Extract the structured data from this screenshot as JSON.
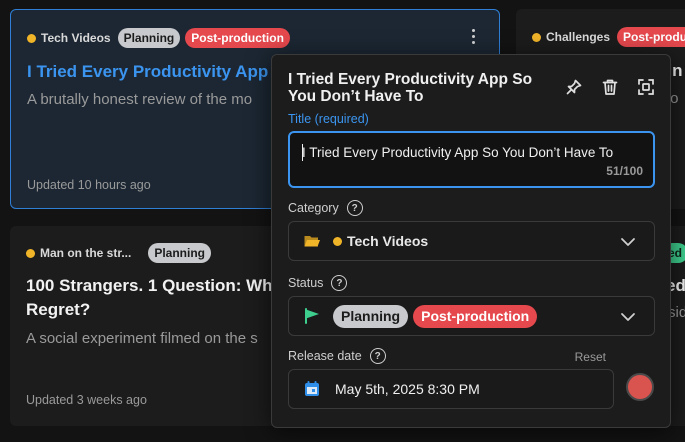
{
  "cards": [
    {
      "category": "Tech Videos",
      "badges": [
        "Planning",
        "Post-production"
      ],
      "title": "I Tried Every Productivity App S",
      "description": "A brutally honest review of the mo",
      "updated": "Updated 10 hours ago"
    },
    {
      "category": "Man on the str...",
      "badges": [
        "Planning"
      ],
      "title_line1": "100 Strangers. 1 Question: Wh",
      "title_line2": "Regret?",
      "description": "A social experiment filmed on the s",
      "updated": "Updated 3 weeks ago"
    },
    {
      "category": "Challenges",
      "badges": [
        "Post-produc"
      ],
      "title": "kin",
      "description": "to"
    },
    {
      "badges": [
        "ed"
      ],
      "title": "ed",
      "description": "sid"
    }
  ],
  "modal": {
    "title": "I Tried Every Productivity App So You Don’t Have To",
    "title_field": {
      "label": "Title (required)",
      "value": "I Tried Every Productivity App So You Don’t Have To",
      "counter": "51/100"
    },
    "category_field": {
      "label": "Category",
      "value": "Tech Videos"
    },
    "status_field": {
      "label": "Status",
      "values": [
        "Planning",
        "Post-production"
      ]
    },
    "release_field": {
      "label": "Release date",
      "reset": "Reset",
      "value": "May 5th, 2025 8:30 PM"
    }
  },
  "colors": {
    "accent": "#3b95f0",
    "badge_red": "#e5484d",
    "badge_gray": "#c7c9cc",
    "category_dot": "#f0b429",
    "swatch": "#d9534f",
    "flag": "#3ecf8e"
  },
  "icons": [
    "more-vertical-icon",
    "pin-icon",
    "trash-icon",
    "expand-icon",
    "help-icon",
    "folder-icon",
    "chevron-down-icon",
    "flag-icon",
    "calendar-icon"
  ]
}
